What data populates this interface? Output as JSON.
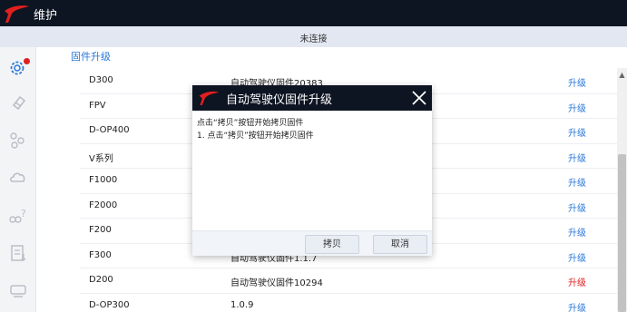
{
  "window": {
    "title": "维护"
  },
  "status": {
    "text": "未连接"
  },
  "section": {
    "title": "固件升级"
  },
  "firmware_rows": [
    {
      "name": "D300",
      "version": "自动驾驶仪固件20383",
      "action": "升级",
      "action_color": "#2b78d8"
    },
    {
      "name": "FPV",
      "version": "",
      "action": "升级",
      "action_color": "#2b78d8"
    },
    {
      "name": "D-OP400",
      "version": "",
      "action": "升级",
      "action_color": "#2b78d8"
    },
    {
      "name": "V系列",
      "version": "",
      "action": "升级",
      "action_color": "#2b78d8"
    },
    {
      "name": "F1000",
      "version": "",
      "action": "升级",
      "action_color": "#2b78d8"
    },
    {
      "name": "F2000",
      "version": "",
      "action": "升级",
      "action_color": "#2b78d8"
    },
    {
      "name": "F200",
      "version": "",
      "action": "升级",
      "action_color": "#2b78d8"
    },
    {
      "name": "F300",
      "version": "自动驾驶仪固件1.1.7",
      "action": "升级",
      "action_color": "#2b78d8"
    },
    {
      "name": "D200",
      "version": "自动驾驶仪固件10294",
      "action": "升级",
      "action_color": "#e02020"
    },
    {
      "name": "D-OP300",
      "version": "1.0.9",
      "action": "升级",
      "action_color": "#2b78d8"
    }
  ],
  "sidebar": {
    "items": [
      {
        "icon": "settings-gear-icon",
        "active": true,
        "notification": true
      },
      {
        "icon": "eraser-icon"
      },
      {
        "icon": "sliders-icon"
      },
      {
        "icon": "cloud-icon"
      },
      {
        "icon": "help-icon"
      },
      {
        "icon": "log-list-icon"
      },
      {
        "icon": "device-icon"
      }
    ]
  },
  "dialog": {
    "title": "自动驾驶仪固件升级",
    "line1": "点击“拷贝”按钮开始拷贝固件",
    "line2": "1. 点击“拷贝”按钮开始拷贝固件",
    "copy_button": "拷贝",
    "cancel_button": "取消"
  },
  "colors": {
    "titlebar": "#0d1422",
    "accent": "#2b78d8",
    "brand_red": "#e01f1f",
    "status_bar": "#e2e7f1"
  }
}
